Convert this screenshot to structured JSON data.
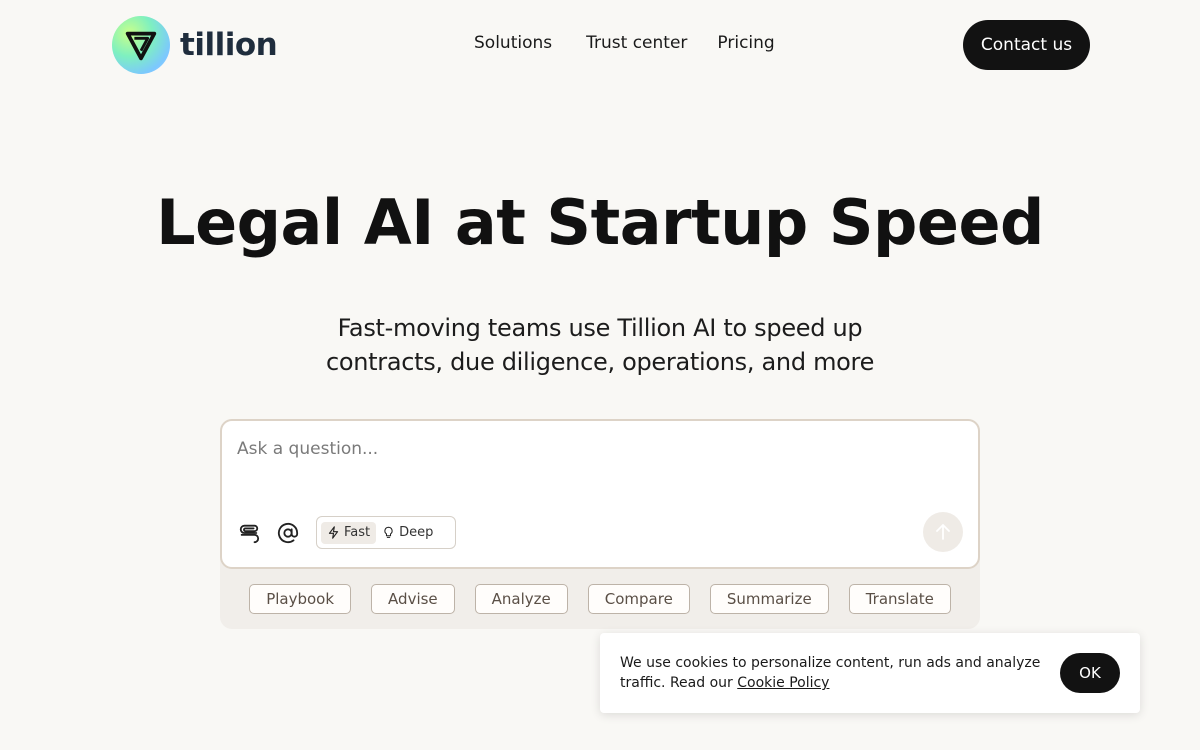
{
  "brand": {
    "name": "tillion"
  },
  "nav": {
    "items": [
      {
        "label": "Solutions"
      },
      {
        "label": "Trust center"
      },
      {
        "label": "Pricing"
      }
    ],
    "contact_label": "Contact us"
  },
  "hero": {
    "title": "Legal AI at Startup Speed",
    "subtitle_line1": "Fast-moving teams use Tillion AI to speed up",
    "subtitle_line2": "contracts, due diligence, operations, and more"
  },
  "ask": {
    "placeholder": "Ask a question...",
    "modes": [
      {
        "label": "Fast",
        "icon": "lightning-icon",
        "active": true
      },
      {
        "label": "Deep",
        "icon": "lightbulb-icon",
        "active": false
      }
    ],
    "icons": {
      "attach": "paperclip-icon",
      "mention": "at-sign-icon",
      "send": "arrow-up-icon"
    }
  },
  "chips": [
    {
      "label": "Playbook"
    },
    {
      "label": "Advise"
    },
    {
      "label": "Analyze"
    },
    {
      "label": "Compare"
    },
    {
      "label": "Summarize"
    },
    {
      "label": "Translate"
    }
  ],
  "cookie": {
    "text": "We use cookies to personalize content, run ads and analyze traffic. Read our",
    "link_label": "Cookie Policy",
    "ok_label": "OK"
  },
  "colors": {
    "background": "#f9f8f5",
    "primary_button": "#121212",
    "brand_text": "#1f2d3d"
  }
}
